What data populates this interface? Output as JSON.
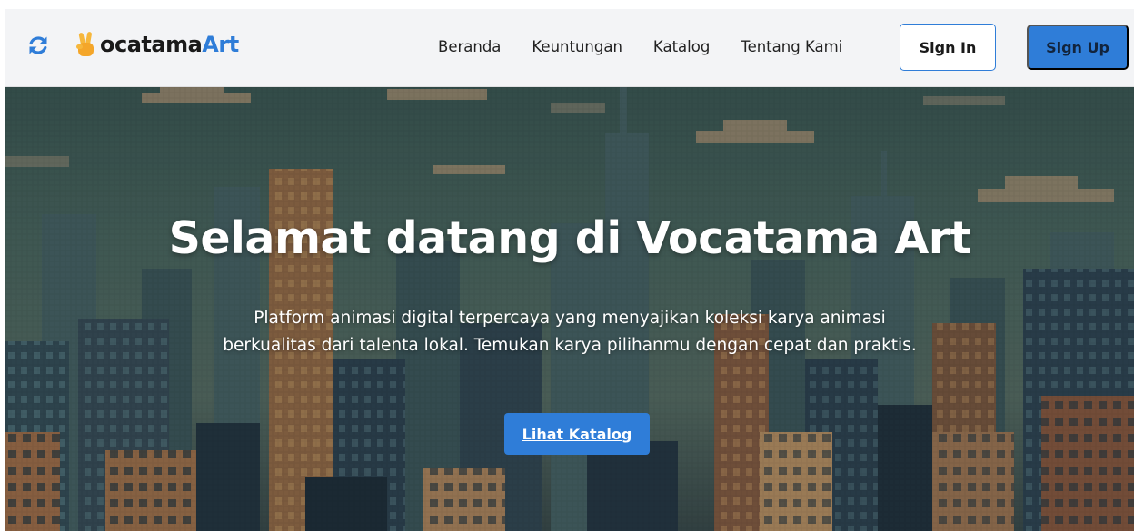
{
  "header": {
    "brand": {
      "prefix": "ocatama",
      "accent": "Art"
    },
    "nav": [
      "Beranda",
      "Keuntungan",
      "Katalog",
      "Tentang Kami"
    ],
    "signin_label": "Sign In",
    "signup_label": "Sign Up",
    "icons": {
      "refresh": "refresh-icon",
      "logo": "victory-hand-icon"
    }
  },
  "hero": {
    "title": "Selamat datang di Vocatama Art",
    "description": "Platform animasi digital terpercaya yang menyajikan koleksi karya animasi berkualitas dari talenta lokal. Temukan karya pilihanmu dengan cepat dan praktis.",
    "cta_label": "Lihat Katalog",
    "background": "pixel-art-city-skyline"
  },
  "colors": {
    "accent": "#2f7dd8",
    "header_bg": "#f3f4f6",
    "hero_text": "#ffffff"
  }
}
